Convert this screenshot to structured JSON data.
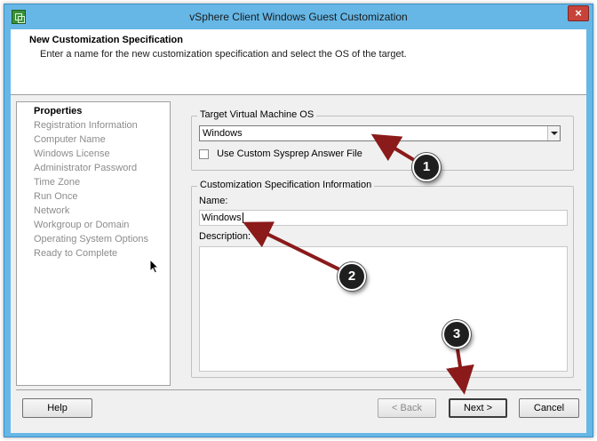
{
  "window": {
    "title": "vSphere Client Windows Guest Customization",
    "close_glyph": "×"
  },
  "header": {
    "title": "New Customization Specification",
    "subtitle": "Enter a name for the new customization specification and select the OS of the target."
  },
  "steps": [
    {
      "label": "Properties",
      "active": true
    },
    {
      "label": "Registration Information",
      "active": false
    },
    {
      "label": "Computer Name",
      "active": false
    },
    {
      "label": "Windows License",
      "active": false
    },
    {
      "label": "Administrator Password",
      "active": false
    },
    {
      "label": "Time Zone",
      "active": false
    },
    {
      "label": "Run Once",
      "active": false
    },
    {
      "label": "Network",
      "active": false
    },
    {
      "label": "Workgroup or Domain",
      "active": false
    },
    {
      "label": "Operating System Options",
      "active": false
    },
    {
      "label": "Ready to Complete",
      "active": false
    }
  ],
  "target_os": {
    "legend": "Target Virtual Machine OS",
    "selected": "Windows",
    "checkbox_label": "Use Custom Sysprep Answer File",
    "checkbox_checked": false
  },
  "spec_info": {
    "legend": "Customization Specification Information",
    "name_label": "Name:",
    "name_value": "Windows",
    "description_label": "Description:",
    "description_value": ""
  },
  "buttons": {
    "help": "Help",
    "back": "< Back",
    "next": "Next >",
    "cancel": "Cancel"
  },
  "annotations": {
    "badge_1": "1",
    "badge_2": "2",
    "badge_3": "3",
    "arrow_color": "#8b1a1a"
  },
  "colors": {
    "titlebar": "#66b7e6",
    "close_button": "#c7433a",
    "client_bg": "#f0f0f0"
  }
}
